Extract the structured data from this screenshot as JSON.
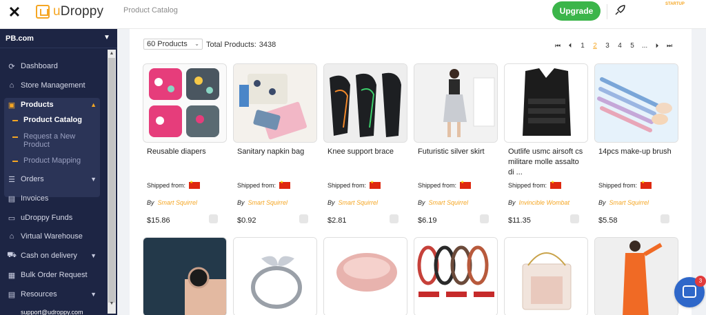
{
  "header": {
    "close_icon": "close-icon",
    "logo_text_u": "u",
    "logo_text_rest": "Droppy",
    "breadcrumb": "Product Catalog",
    "upgrade_label": "Upgrade",
    "plan_label": "STARTUP",
    "rocket_icon": "rocket-icon"
  },
  "sidebar": {
    "store_name": "PB.com",
    "items": [
      {
        "label": "Dashboard",
        "icon": "dashboard-icon"
      },
      {
        "label": "Store Management",
        "icon": "store-icon"
      },
      {
        "label": "Products",
        "icon": "products-icon"
      },
      {
        "label": "Orders",
        "icon": "orders-icon"
      },
      {
        "label": "Invoices",
        "icon": "invoices-icon"
      },
      {
        "label": "uDroppy Funds",
        "icon": "funds-icon"
      },
      {
        "label": "Virtual Warehouse",
        "icon": "warehouse-icon"
      },
      {
        "label": "Cash on delivery",
        "icon": "cash-icon"
      },
      {
        "label": "Bulk Order Request",
        "icon": "bulk-order-icon"
      },
      {
        "label": "Resources",
        "icon": "resources-icon"
      }
    ],
    "products_sub": [
      {
        "label": "Product Catalog"
      },
      {
        "label": "Request a New Product"
      },
      {
        "label": "Product Mapping"
      }
    ],
    "support_email": "support@udroppy.com"
  },
  "toolbar": {
    "per_page_value": "60 Products",
    "total_label": "Total Products:",
    "total_value": "3438"
  },
  "pagination": {
    "pages": [
      "1",
      "2",
      "3",
      "4",
      "5",
      "..."
    ],
    "current": "2"
  },
  "products_row1": [
    {
      "title": "Reusable diapers",
      "ship_label": "Shipped from:",
      "by": "By",
      "seller": "Smart Squirrel",
      "price": "$15.86"
    },
    {
      "title": "Sanitary napkin bag",
      "ship_label": "Shipped from:",
      "by": "By",
      "seller": "Smart Squirrel",
      "price": "$0.92"
    },
    {
      "title": "Knee support brace",
      "ship_label": "Shipped from:",
      "by": "By",
      "seller": "Smart Squirrel",
      "price": "$2.81"
    },
    {
      "title": "Futuristic silver skirt",
      "ship_label": "Shipped from:",
      "by": "By",
      "seller": "Smart Squirrel",
      "price": "$6.19"
    },
    {
      "title": "Outlife usmc airsoft cs militare molle assalto di ...",
      "ship_label": "Shipped from:",
      "by": "By",
      "seller": "Invincible Wombat",
      "price": "$11.35"
    },
    {
      "title": "14pcs make-up brush",
      "ship_label": "Shipped from:",
      "by": "By",
      "seller": "Smart Squirrel",
      "price": "$5.58"
    }
  ],
  "chat": {
    "badge": "3"
  },
  "colors": {
    "accent": "#f5a623",
    "upgrade_green": "#3bb54a",
    "sidebar_bg": "#1d2544",
    "chat_blue": "#2e67c9"
  }
}
